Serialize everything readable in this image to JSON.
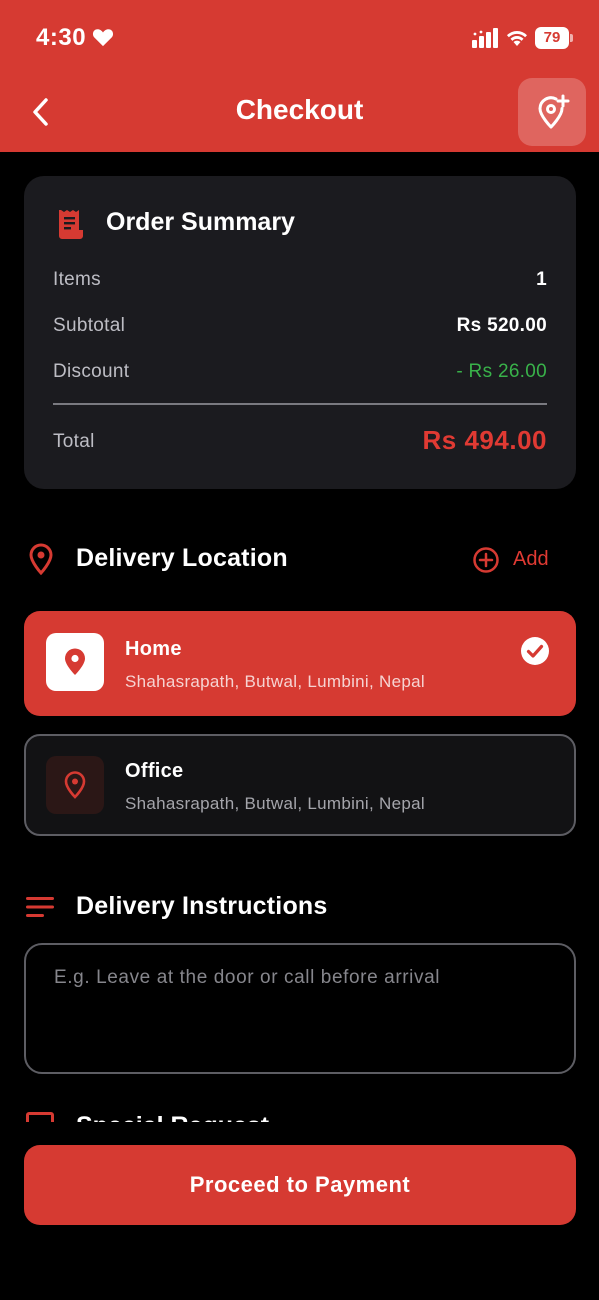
{
  "status_bar": {
    "time": "4:30",
    "battery": "79"
  },
  "header": {
    "title": "Checkout"
  },
  "summary": {
    "heading": "Order Summary",
    "items_label": "Items",
    "items_value": "1",
    "subtotal_label": "Subtotal",
    "subtotal_value": "Rs 520.00",
    "discount_label": "Discount",
    "discount_value": "- Rs 26.00",
    "total_label": "Total",
    "total_value": "Rs 494.00"
  },
  "delivery": {
    "title": "Delivery Location",
    "add_label": "Add",
    "addresses": [
      {
        "name": "Home",
        "line": "Shahasrapath, Butwal, Lumbini, Nepal",
        "selected": true
      },
      {
        "name": "Office",
        "line": "Shahasrapath, Butwal, Lumbini, Nepal",
        "selected": false
      }
    ]
  },
  "instructions": {
    "title": "Delivery Instructions",
    "placeholder": "E.g. Leave at the door or call before arrival"
  },
  "special_request": {
    "title": "Special Request"
  },
  "footer": {
    "cta": "Proceed to Payment"
  },
  "colors": {
    "accent": "#d63a32",
    "discount": "#39b24a",
    "card": "#1b1b1f"
  },
  "icons": [
    "heart-icon",
    "signal-icon",
    "wifi-icon",
    "battery-icon",
    "back-chevron-icon",
    "add-location-icon",
    "receipt-icon",
    "location-pin-icon",
    "add-circle-icon",
    "check-circle-icon",
    "lines-icon"
  ]
}
